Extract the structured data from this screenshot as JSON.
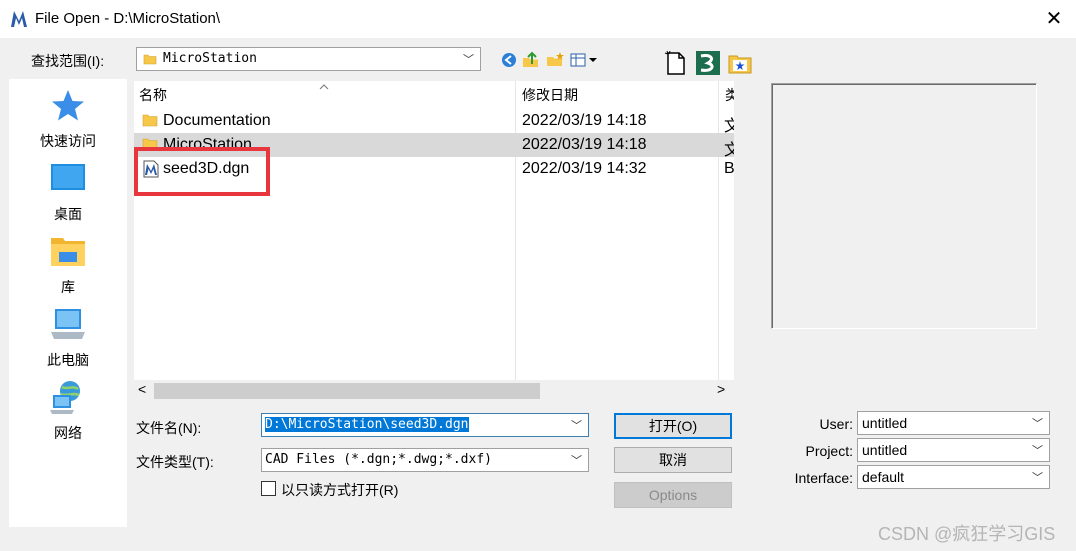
{
  "window": {
    "title": "File Open - D:\\MicroStation\\",
    "close_glyph": "✕"
  },
  "lookin": {
    "label": "查找范围(I):",
    "value": "MicroStation"
  },
  "places": [
    {
      "label": "快速访问",
      "icon": "star-icon"
    },
    {
      "label": "桌面",
      "icon": "desktop-icon"
    },
    {
      "label": "库",
      "icon": "library-icon"
    },
    {
      "label": "此电脑",
      "icon": "computer-icon"
    },
    {
      "label": "网络",
      "icon": "network-icon"
    }
  ],
  "columns": {
    "name": "名称",
    "date": "修改日期",
    "type": "类"
  },
  "files": [
    {
      "name": "Documentation",
      "date": "2022/03/19 14:18",
      "type": "文",
      "icon": "folder-icon"
    },
    {
      "name": "MicroStation",
      "date": "2022/03/19 14:18",
      "type": "文",
      "icon": "folder-icon"
    },
    {
      "name": "seed3D.dgn",
      "date": "2022/03/19 14:32",
      "type": "B",
      "icon": "dgn-file-icon"
    }
  ],
  "filename": {
    "label": "文件名(N):",
    "value": "D:\\MicroStation\\seed3D.dgn"
  },
  "filetype": {
    "label": "文件类型(T):",
    "value": "CAD Files (*.dgn;*.dwg;*.dxf)"
  },
  "readonly": {
    "label": "以只读方式打开(R)",
    "checked": false
  },
  "buttons": {
    "open": "打开(O)",
    "cancel": "取消",
    "options": "Options"
  },
  "workspace": {
    "user_label": "User:",
    "user_value": "untitled",
    "project_label": "Project:",
    "project_value": "untitled",
    "interface_label": "Interface:",
    "interface_value": "default"
  },
  "watermark": "CSDN @疯狂学习GIS",
  "colors": {
    "accent": "#0078d7",
    "highlight_box": "#e8363f",
    "folder": "#f7c74a"
  }
}
